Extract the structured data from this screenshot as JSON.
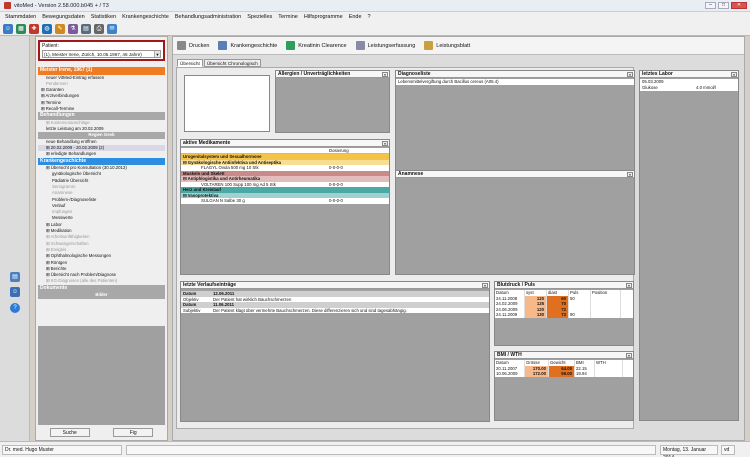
{
  "window": {
    "title": "vitoMed  -  Version 2.58.000.b045 +  / T3",
    "buttons": [
      "–",
      "□",
      "✕"
    ]
  },
  "menu": [
    "Stammdaten",
    "Bewegungsdaten",
    "Statistiken",
    "Krankengeschichte",
    "Behandlungsadministration",
    "Spezielles",
    "Termine",
    "Hilfsprogramme",
    "Ende",
    "?"
  ],
  "toolbar_icons": [
    {
      "name": "user-icon",
      "glyph": "☺",
      "color": "#3b7bc4"
    },
    {
      "name": "calendar-icon",
      "glyph": "▦",
      "color": "#2e8b57"
    },
    {
      "name": "drug-icon",
      "glyph": "✚",
      "color": "#c0392b"
    },
    {
      "name": "globe-icon",
      "glyph": "◍",
      "color": "#1f6fb2"
    },
    {
      "name": "tools-icon",
      "glyph": "✎",
      "color": "#d08a1c"
    },
    {
      "name": "lab-icon",
      "glyph": "⚗",
      "color": "#7a5c9e"
    },
    {
      "name": "doc-icon",
      "glyph": "▤",
      "color": "#5a6b7d"
    },
    {
      "name": "print-icon",
      "glyph": "⎙",
      "color": "#666"
    },
    {
      "name": "note-icon",
      "glyph": "✉",
      "color": "#3c83c8"
    }
  ],
  "patient": {
    "label": "Patient:",
    "value": "(1), Meister Irene, Zürich, 10.05.1967, 46 Jahre)"
  },
  "tree": [
    {
      "type": "hdr",
      "text": "Meister Irene, 1967 (1)",
      "color": "#f07b22"
    },
    {
      "type": "row",
      "text": "neuer VitMed-Eintrag erfassen",
      "indent": 8
    },
    {
      "type": "row",
      "text": "Pendenzen",
      "indent": 8,
      "grey": true
    },
    {
      "type": "row",
      "text": "⊞  Garanten",
      "indent": 3
    },
    {
      "type": "row",
      "text": "⊞  Arztverbindungen",
      "indent": 3
    },
    {
      "type": "row",
      "text": "⊞  Termine",
      "indent": 3
    },
    {
      "type": "row",
      "text": "⊞  Recall-Termine",
      "indent": 3
    },
    {
      "type": "hdr",
      "text": "Behandlungen",
      "color": "#a8a8a8"
    },
    {
      "type": "row",
      "text": "⊞  Kostenvoranschläge",
      "indent": 8,
      "grey": true
    },
    {
      "type": "row",
      "text": "letzte Leistung am 20.02.2009",
      "indent": 8
    },
    {
      "type": "sub",
      "text": "Regien     Gesb"
    },
    {
      "type": "row",
      "text": "neue Behandlung eröffnen",
      "indent": 8
    },
    {
      "type": "row",
      "text": "⊞  20.02.2009 - 20.02.2009 (2)",
      "indent": 8,
      "bg": "#d8d8e6"
    },
    {
      "type": "row",
      "text": "⊞  erledigte Behandlungen",
      "indent": 8
    },
    {
      "type": "hdr",
      "text": "Krankengeschichte",
      "color": "#2d8de0"
    },
    {
      "type": "row",
      "text": "⊞  Übersicht pro Konsultation (30.10.2013)",
      "indent": 8
    },
    {
      "type": "row",
      "text": "gynäkologische Übersicht",
      "indent": 14
    },
    {
      "type": "row",
      "text": "Pädiatrie Übersicht",
      "indent": 14
    },
    {
      "type": "row",
      "text": "Seriogramm",
      "indent": 14,
      "grey": true
    },
    {
      "type": "row",
      "text": "Anamnese",
      "indent": 14,
      "grey": true
    },
    {
      "type": "row",
      "text": "Problem-/Diagnoseliste",
      "indent": 14
    },
    {
      "type": "row",
      "text": "Verlauf",
      "indent": 14
    },
    {
      "type": "row",
      "text": "Impfungen",
      "indent": 14,
      "grey": true
    },
    {
      "type": "row",
      "text": "Messwerte",
      "indent": 14
    },
    {
      "type": "row",
      "text": "⊞  Labor",
      "indent": 8
    },
    {
      "type": "row",
      "text": "⊞  Medikation",
      "indent": 8
    },
    {
      "type": "row",
      "text": "⊞  Arbeitsunfähigkeiten",
      "indent": 8,
      "grey": true
    },
    {
      "type": "row",
      "text": "⊞  Schwangerschaften",
      "indent": 8,
      "grey": true
    },
    {
      "type": "row",
      "text": "⊞  Ereignis",
      "indent": 8,
      "grey": true
    },
    {
      "type": "row",
      "text": "⊞  Ophthalmologische Messungen",
      "indent": 8
    },
    {
      "type": "row",
      "text": "⊞  Röntgen",
      "indent": 8
    },
    {
      "type": "row",
      "text": "⊞  Berichte",
      "indent": 8
    },
    {
      "type": "row",
      "text": "⊞  Übersicht nach Problem/Diagnose",
      "indent": 8
    },
    {
      "type": "row",
      "text": "⊞  KG-Diagnosen (alle des Patienten)",
      "indent": 8,
      "grey": true
    },
    {
      "type": "hdr",
      "text": "Dokumente",
      "color": "#a8a8a8"
    },
    {
      "type": "sub",
      "text": "Bilder"
    }
  ],
  "nav_buttons": [
    "Suche",
    "Fig"
  ],
  "main_toolbar": [
    {
      "label": "Drucken",
      "color": "#888"
    },
    {
      "label": "Krankengeschichte",
      "color": "#5a7fb5"
    },
    {
      "label": "Kreatinin Clearence",
      "color": "#2e9e5b"
    },
    {
      "label": "Leistungserfassung",
      "color": "#8a8aa8"
    },
    {
      "label": "Leistungsblatt",
      "color": "#c8a040"
    }
  ],
  "tabs": [
    "Übersicht",
    "Übersicht Chronologisch"
  ],
  "allergien": {
    "title": "Allergien / Unverträglichkeiten"
  },
  "diagnoseliste": {
    "title": "Diagnoseliste",
    "items": [
      "Lebensmittelvergiftung durch Bacillus cereus (A05.4)"
    ]
  },
  "labor": {
    "title": "letztes Labor",
    "date": "05.03.2009",
    "rows": [
      {
        "name": "Glukose",
        "value": "4.0 mmol/l"
      }
    ]
  },
  "medikamente": {
    "title": "aktive Medikamente",
    "col": "Dosierung",
    "rows": [
      {
        "kind": "cat",
        "text": "Urogenitalsystem und Sexualhormone",
        "bg": "#f4c44a"
      },
      {
        "kind": "sub",
        "text": "⊟  Gynäkologische Antiinfektiva und Antiseptika",
        "bg": "#f9dd93"
      },
      {
        "kind": "item",
        "text": "FLAGYL Ovula 500 mg 10 Stk",
        "dose": "0-0-0-0"
      },
      {
        "kind": "cat",
        "text": "Muskeln und Skelett",
        "bg": "#c98a8a"
      },
      {
        "kind": "sub",
        "text": "⊟  Antiphlogistika und Antirheumatika",
        "bg": "#e3bcbc"
      },
      {
        "kind": "item",
        "text": "VOLTAREN 100 Supp 100 mg Ad 5 Stk",
        "dose": "0-0-0-0"
      },
      {
        "kind": "cat",
        "text": "Herz und Kreislauf",
        "bg": "#4aa9a5"
      },
      {
        "kind": "sub",
        "text": "⊟  Vasoprotektiva",
        "bg": "#9fd2cf"
      },
      {
        "kind": "item",
        "text": "SULGAN N Salbe 30 g",
        "dose": "0-0-0-0"
      }
    ]
  },
  "anamnese": {
    "title": "Anamnese"
  },
  "verlauf": {
    "title": "letzte Verlaufseinträge",
    "rows": [
      {
        "kind": "date",
        "label": "Datum",
        "value": "12.06.2011"
      },
      {
        "kind": "txt",
        "label": "Objektiv",
        "value": "Der Patient hat wirklich Bauchschmerzen"
      },
      {
        "kind": "date",
        "label": "Datum",
        "value": "11.06.2011"
      },
      {
        "kind": "txt",
        "label": "Subjektiv",
        "value": "Der Patient klagt über vermehrte Bauchschmerzen. Diese differenzieren sich und sind tagesabhängig."
      }
    ]
  },
  "blutdruck": {
    "title": "Blutdruck / Puls",
    "headers": [
      "Datum",
      "syst",
      "diast",
      "Puls",
      "Position"
    ],
    "rows": [
      [
        "24.11.2008",
        "120",
        "60",
        "50",
        ""
      ],
      [
        "24.02.2009",
        "125",
        "70",
        "",
        ""
      ],
      [
        "24.06.2009",
        "120",
        "72",
        "",
        ""
      ],
      [
        "24.11.2009",
        "130",
        "73",
        "90",
        ""
      ]
    ]
  },
  "bmi": {
    "title": "BMI / WTH",
    "headers": [
      "Datum",
      "Grösse",
      "Gewicht",
      "BMI",
      "WTH"
    ],
    "rows": [
      [
        "20.11.2007",
        "170.00",
        "64.00",
        "22.15",
        ""
      ],
      [
        "10.06.2009",
        "172.00",
        "59.00",
        "19.94",
        ""
      ]
    ]
  },
  "status": {
    "user": "Dr. med. Hugo Muster",
    "date": "Montag, 13. Januar 2014",
    "code": "vd"
  },
  "colors": {
    "orange": "#f07b22",
    "light_orange": "#f8b98a",
    "dark_orange": "#e07020"
  }
}
